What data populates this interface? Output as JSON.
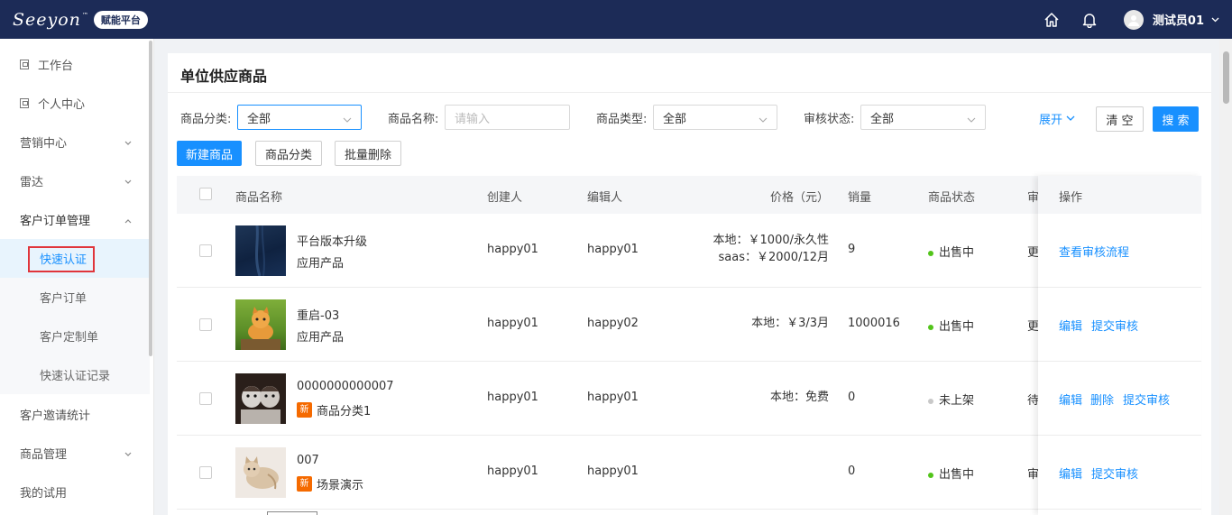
{
  "header": {
    "logo_text": "Seeyon",
    "logo_tm": "™",
    "logo_badge": "赋能平台",
    "user_name": "测试员01",
    "icons": [
      "home-icon",
      "bell-icon",
      "user-avatar-icon",
      "chevron-down-icon"
    ]
  },
  "sidebar": {
    "items": [
      {
        "label": "工作台"
      },
      {
        "label": "个人中心"
      },
      {
        "label": "营销中心"
      },
      {
        "label": "雷达"
      },
      {
        "label": "客户订单管理"
      },
      {
        "label": "客户邀请统计"
      },
      {
        "label": "商品管理"
      },
      {
        "label": "我的试用"
      }
    ],
    "sub_items": [
      {
        "label": "快速认证"
      },
      {
        "label": "客户订单"
      },
      {
        "label": "客户定制单"
      },
      {
        "label": "快速认证记录"
      }
    ]
  },
  "page": {
    "title": "单位供应商品"
  },
  "filters": {
    "category_label": "商品分类:",
    "category_value": "全部",
    "name_label": "商品名称:",
    "name_placeholder": "请输入",
    "type_label": "商品类型:",
    "type_value": "全部",
    "audit_label": "审核状态:",
    "audit_value": "全部",
    "expand_label": "展开",
    "clear_label": "清 空",
    "search_label": "搜 索"
  },
  "toolbar": {
    "new_label": "新建商品",
    "category_label": "商品分类",
    "batch_delete_label": "批量删除"
  },
  "table": {
    "headers": {
      "name": "商品名称",
      "creator": "创建人",
      "editor": "编辑人",
      "price": "价格（元）",
      "sales": "销量",
      "status": "商品状态",
      "audit": "审",
      "ops": "操作"
    },
    "rows": [
      {
        "name": "平台版本升级",
        "type": "应用产品",
        "is_new": false,
        "creator": "happy01",
        "editor": "happy01",
        "price_line1": "本地：￥1000/永久性",
        "price_line2": "saas：￥2000/12月",
        "sales": "9",
        "status": "出售中",
        "status_color": "green",
        "audit": "更",
        "ops": [
          "查看审核流程"
        ]
      },
      {
        "name": "重启-03",
        "type": "应用产品",
        "is_new": false,
        "creator": "happy01",
        "editor": "happy02",
        "price_line1": "本地：￥3/3月",
        "price_line2": "",
        "sales": "1000016",
        "status": "出售中",
        "status_color": "green",
        "audit": "更",
        "ops": [
          "编辑",
          "提交审核"
        ]
      },
      {
        "name": "0000000000007",
        "type": "商品分类1",
        "is_new": true,
        "new_tag": "新",
        "creator": "happy01",
        "editor": "happy01",
        "price_line1": "本地：免费",
        "price_line2": "",
        "sales": "0",
        "status": "未上架",
        "status_color": "gray",
        "audit": "待",
        "ops": [
          "编辑",
          "删除",
          "提交审核"
        ]
      },
      {
        "name": "007",
        "type": "场景演示",
        "is_new": true,
        "new_tag": "新",
        "creator": "happy01",
        "editor": "happy01",
        "price_line1": "",
        "price_line2": "",
        "sales": "0",
        "status": "出售中",
        "status_color": "green",
        "audit": "审",
        "ops": [
          "编辑",
          "提交审核"
        ]
      }
    ]
  },
  "colors": {
    "topbar": "#1c2b57",
    "primary": "#1890ff",
    "status_green": "#52c41a",
    "status_gray": "#c8c8c8",
    "new_tag": "#f56a00",
    "highlight_border": "#e0353b"
  }
}
